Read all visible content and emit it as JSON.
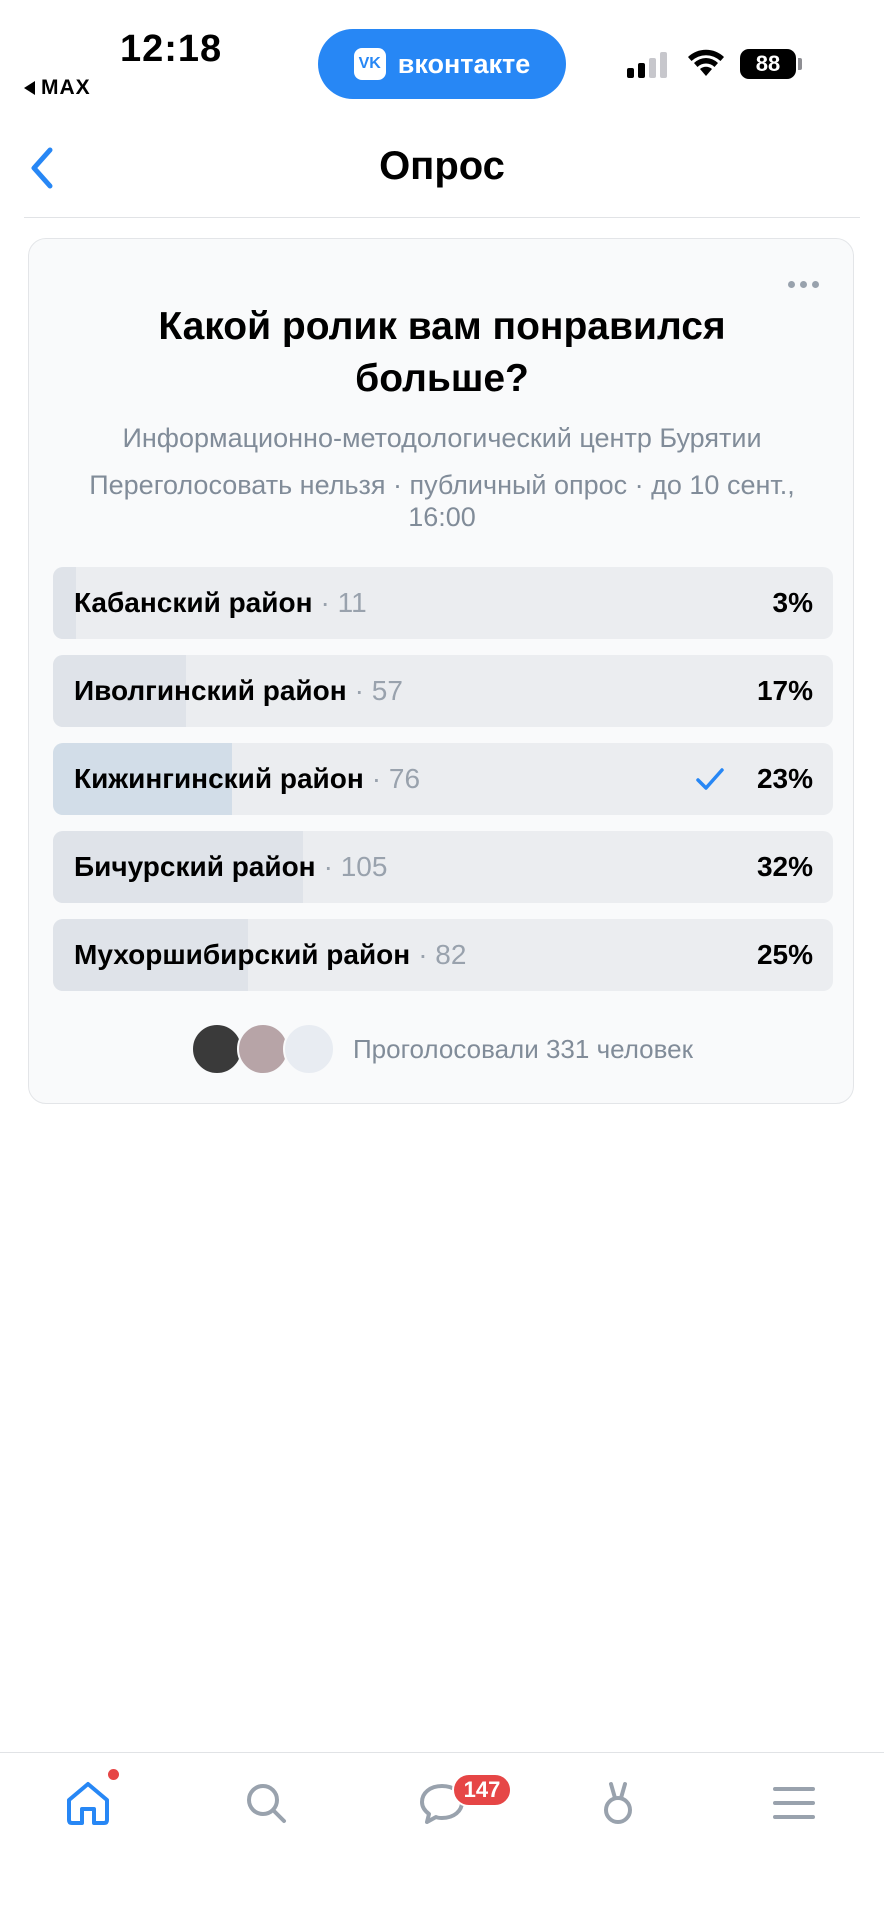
{
  "status_bar": {
    "time": "12:18",
    "back_app": "MAX",
    "vk_label": "вконтакте",
    "vk_logo": "VK",
    "battery": "88"
  },
  "nav": {
    "title": "Опрос"
  },
  "poll": {
    "question": "Какой ролик вам понравился больше?",
    "author": "Информационно-методологический центр Бурятии",
    "meta": "Переголосовать нельзя · публичный опрос · до 10 сент., 16:00",
    "options": [
      {
        "label": "Кабанский район",
        "count": "· 11",
        "percent": "3%",
        "fraction": 0.03,
        "selected": false
      },
      {
        "label": "Иволгинский район",
        "count": "· 57",
        "percent": "17%",
        "fraction": 0.17,
        "selected": false
      },
      {
        "label": "Кижингинский район",
        "count": "· 76",
        "percent": "23%",
        "fraction": 0.23,
        "selected": true
      },
      {
        "label": "Бичурский район",
        "count": "· 105",
        "percent": "32%",
        "fraction": 0.32,
        "selected": false
      },
      {
        "label": "Мухоршибирский район",
        "count": "· 82",
        "percent": "25%",
        "fraction": 0.25,
        "selected": false
      }
    ],
    "voters_text": "Проголосовали 331 человек"
  },
  "tabbar": {
    "items": [
      "home-icon",
      "search-icon",
      "messenger-icon",
      "clips-icon",
      "menu-icon"
    ],
    "messages_badge": "147"
  },
  "colors": {
    "accent": "#2787f5",
    "badge": "#e64646",
    "secondary_text": "#818c99"
  }
}
